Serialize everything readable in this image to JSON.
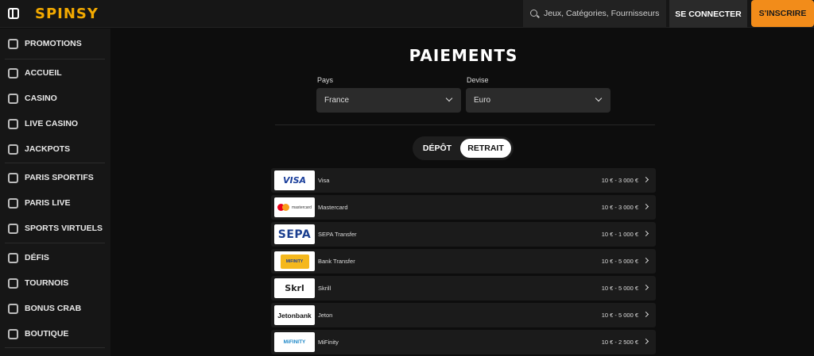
{
  "header": {
    "logo": "SPINSY",
    "search_placeholder": "Jeux, Catégories, Fournisseurs",
    "login_label": "SE CONNECTER",
    "signup_label": "S'INSCRIRE"
  },
  "sidebar": {
    "items": [
      {
        "label": "PROMOTIONS",
        "icon": "gift-icon"
      },
      {
        "label": "ACCUEIL",
        "icon": "home-icon"
      },
      {
        "label": "CASINO",
        "icon": "slot-machine-icon"
      },
      {
        "label": "LIVE CASINO",
        "icon": "live-dealer-icon"
      },
      {
        "label": "JACKPOTS",
        "icon": "jackpot-icon"
      },
      {
        "label": "PARIS SPORTIFS",
        "icon": "soccer-ball-icon"
      },
      {
        "label": "PARIS LIVE",
        "icon": "live-tv-icon"
      },
      {
        "label": "SPORTS VIRTUELS",
        "icon": "virtual-sports-icon"
      },
      {
        "label": "DÉFIS",
        "icon": "challenge-icon"
      },
      {
        "label": "TOURNOIS",
        "icon": "trophy-icon"
      },
      {
        "label": "BONUS CRAB",
        "icon": "crab-icon"
      },
      {
        "label": "BOUTIQUE",
        "icon": "shop-icon"
      }
    ]
  },
  "main": {
    "title": "PAIEMENTS",
    "country_label": "Pays",
    "country_value": "France",
    "currency_label": "Devise",
    "currency_value": "Euro",
    "tabs": {
      "deposit": "DÉPÔT",
      "withdraw": "RETRAIT",
      "active": "withdraw"
    },
    "methods": [
      {
        "name": "Visa",
        "limits": "10 € - 3 000 €",
        "logo": "visa-logo"
      },
      {
        "name": "Mastercard",
        "limits": "10 € - 3 000 €",
        "logo": "mastercard-logo"
      },
      {
        "name": "SEPA Transfer",
        "limits": "10 € - 1 000 €",
        "logo": "sepa-logo"
      },
      {
        "name": "Bank Transfer",
        "limits": "10 € - 5 000 €",
        "logo": "bank-transfer-logo"
      },
      {
        "name": "Skrill",
        "limits": "10 € - 5 000 €",
        "logo": "skrill-logo"
      },
      {
        "name": "Jeton",
        "limits": "10 € - 5 000 €",
        "logo": "jeton-logo"
      },
      {
        "name": "MiFinity",
        "limits": "10 € - 2 500 €",
        "logo": "mifinity-logo"
      }
    ]
  },
  "logos": {
    "visa": "VISA",
    "mastercard": "mastercard",
    "sepa": "SEPA",
    "bank_transfer": "MIFINITY",
    "skrill": "Skrl",
    "jeton": "Jetonbank",
    "mifinity": "MiFINITY"
  },
  "colors": {
    "brand": "#f2a900",
    "signup": "#f28c1a",
    "background": "#0d0d0d",
    "panel": "#1b1b1b"
  }
}
